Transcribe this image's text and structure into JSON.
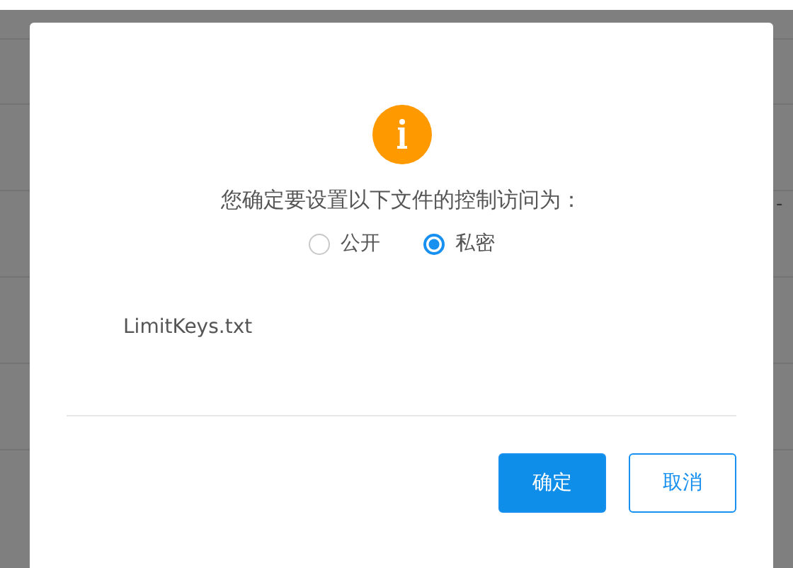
{
  "background_table": {
    "cells": [
      "-"
    ]
  },
  "dialog": {
    "message": "您确定要设置以下文件的控制访问为：",
    "options": [
      {
        "label": "公开",
        "selected": false
      },
      {
        "label": "私密",
        "selected": true
      }
    ],
    "file": "LimitKeys.txt",
    "buttons": [
      {
        "label": "确定",
        "kind": "primary"
      },
      {
        "label": "取消",
        "kind": "secondary"
      }
    ]
  }
}
